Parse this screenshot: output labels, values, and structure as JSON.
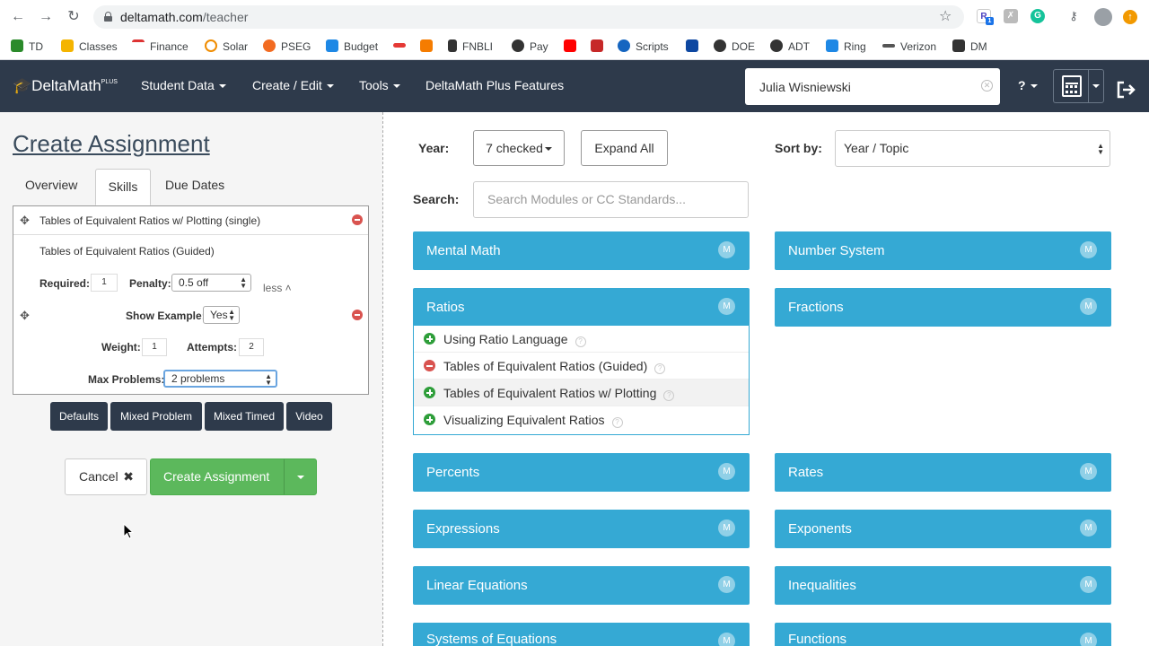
{
  "browser": {
    "url_host": "deltamath.com",
    "url_path": "/teacher",
    "bookmarks": [
      "TD",
      "Classes",
      "Finance",
      "Solar",
      "PSEG",
      "Budget",
      "FNBLI",
      "Pay",
      "Scripts",
      "DOE",
      "ADT",
      "Ring",
      "Verizon",
      "DM"
    ],
    "ext_badge": "1"
  },
  "appnav": {
    "brand": "DeltaMath",
    "brand_plus": "PLUS",
    "items": [
      "Student Data",
      "Create / Edit",
      "Tools",
      "DeltaMath Plus Features"
    ],
    "student": "Julia Wisniewski",
    "help": "?"
  },
  "left": {
    "title": "Create Assignment",
    "tabs": [
      "Overview",
      "Skills",
      "Due Dates"
    ],
    "skill_title": "Tables of Equivalent Ratios w/ Plotting (single)",
    "sub_skill": "Tables of Equivalent Ratios (Guided)",
    "required_label": "Required:",
    "required_value": "1",
    "penalty_label": "Penalty:",
    "penalty_value": "0.5 off",
    "less": "less",
    "show_example_label": "Show Example:",
    "show_example_value": "Yes",
    "weight_label": "Weight:",
    "weight_value": "1",
    "attempts_label": "Attempts:",
    "attempts_value": "2",
    "max_problems_label": "Max Problems:",
    "max_problems_value": "2 problems",
    "buttons": [
      "Defaults",
      "Mixed Problem",
      "Mixed Timed",
      "Video"
    ],
    "cancel": "Cancel",
    "create": "Create Assignment"
  },
  "right": {
    "year_label": "Year:",
    "year_value": "7 checked",
    "expand_all": "Expand All",
    "sort_label": "Sort by:",
    "sort_value": "Year / Topic",
    "search_label": "Search:",
    "search_placeholder": "Search Modules or CC Standards...",
    "m_badge": "M",
    "modules": {
      "mental_math": "Mental Math",
      "number_system": "Number System",
      "ratios": "Ratios",
      "fractions": "Fractions",
      "percents": "Percents",
      "rates": "Rates",
      "expressions": "Expressions",
      "exponents": "Exponents",
      "linear_equations": "Linear Equations",
      "inequalities": "Inequalities",
      "systems_of_equations": "Systems of Equations",
      "functions": "Functions"
    },
    "ratio_items": [
      "Using Ratio Language",
      "Tables of Equivalent Ratios (Guided)",
      "Tables of Equivalent Ratios w/ Plotting",
      "Visualizing Equivalent Ratios"
    ]
  }
}
